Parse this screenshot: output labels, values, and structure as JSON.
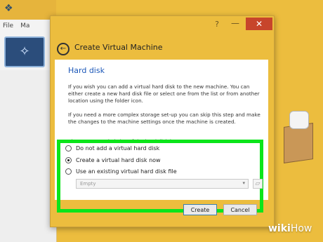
{
  "background_app": {
    "menu": [
      "File",
      "Ma"
    ]
  },
  "dialog": {
    "titlebar": {
      "help": "?",
      "minimize": "—",
      "close": "✕"
    },
    "title": "Create Virtual Machine",
    "section_title": "Hard disk",
    "paragraph1": "If you wish you can add a virtual hard disk to the new machine. You can either create a new hard disk file or select one from the list or from another location using the folder icon.",
    "paragraph2": "If you need a more complex storage set-up you can skip this step and make the changes to the machine settings once the machine is created.",
    "paragraph3_prefix": "The recommended size of the hard disk is ",
    "recommended_size": "32.00 GB",
    "paragraph3_suffix": ".",
    "options": [
      {
        "label": "Do not add a virtual hard disk",
        "selected": false
      },
      {
        "label": "Create a virtual hard disk now",
        "selected": true
      },
      {
        "label": "Use an existing virtual hard disk file",
        "selected": false
      }
    ],
    "existing_disk_combo": "Empty",
    "buttons": {
      "create": "Create",
      "cancel": "Cancel"
    }
  },
  "watermark": {
    "wiki": "wiki",
    "how": "How"
  },
  "colors": {
    "highlight": "#0be51a",
    "title_accent": "#1b57b8",
    "window_frame": "#ecbd3e"
  }
}
